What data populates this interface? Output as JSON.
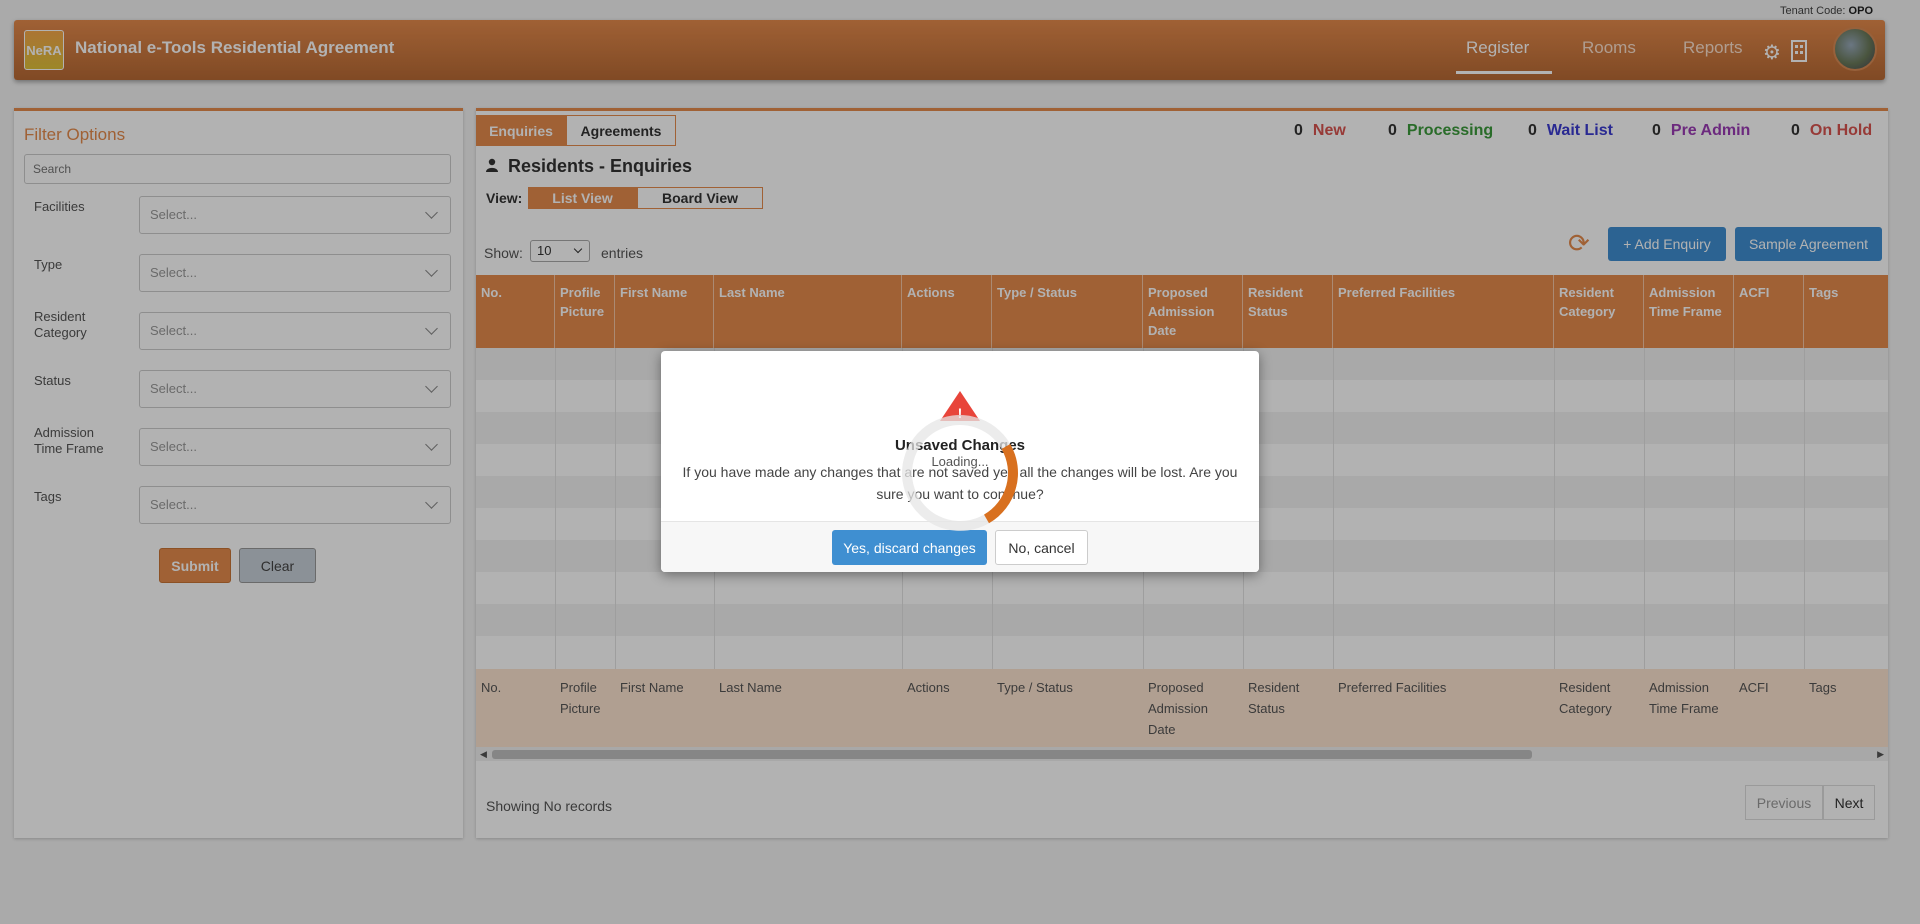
{
  "tenant": {
    "label": "Tenant Code:",
    "code": "OPO"
  },
  "header": {
    "logo_text": "NeRA",
    "title": "National e-Tools Residential Agreement",
    "nav": [
      "Register",
      "Rooms",
      "Reports"
    ],
    "icons": [
      "gear-icon",
      "building-icon"
    ]
  },
  "filters": {
    "title": "Filter Options",
    "search_placeholder": "Search",
    "fields": [
      {
        "label": "Facilities",
        "placeholder": "Select..."
      },
      {
        "label": "Type",
        "placeholder": "Select..."
      },
      {
        "label": "Resident Category",
        "placeholder": "Select..."
      },
      {
        "label": "Status",
        "placeholder": "Select..."
      },
      {
        "label": "Admission Time Frame",
        "placeholder": "Select..."
      },
      {
        "label": "Tags",
        "placeholder": "Select..."
      }
    ],
    "submit": "Submit",
    "clear": "Clear"
  },
  "main": {
    "tabs": [
      "Enquiries",
      "Agreements"
    ],
    "statuses": [
      {
        "count": "0",
        "label": "New",
        "color": "#d9534f"
      },
      {
        "count": "0",
        "label": "Processing",
        "color": "#3c9b3c"
      },
      {
        "count": "0",
        "label": "Wait List",
        "color": "#3b3bd1"
      },
      {
        "count": "0",
        "label": "Pre Admin",
        "color": "#9b3cb5"
      },
      {
        "count": "0",
        "label": "On Hold",
        "color": "#d9534f"
      }
    ],
    "section_title": "Residents - Enquiries",
    "view_label": "View:",
    "views": [
      "List View",
      "Board View"
    ],
    "show_label": "Show:",
    "show_value": "10",
    "entries_label": "entries",
    "add_enquiry": "+ Add Enquiry",
    "sample_agreement": "Sample Agreement",
    "columns": [
      "No.",
      "Profile Picture",
      "First Name",
      "Last Name",
      "Actions",
      "Type / Status",
      "Proposed Admission Date",
      "Resident Status",
      "Preferred Facilities",
      "Resident Category",
      "Admission Time Frame",
      "ACFI",
      "Tags"
    ],
    "showing": "Showing No records",
    "pager": {
      "previous": "Previous",
      "next": "Next"
    }
  },
  "modal": {
    "warn_mark": "!",
    "title": "Unsaved Changes",
    "text": "If you have made any changes that are not saved yet, all the changes will be lost. Are you sure you want to continue?",
    "yes": "Yes, discard changes",
    "no": "No, cancel"
  },
  "loading": "Loading..."
}
